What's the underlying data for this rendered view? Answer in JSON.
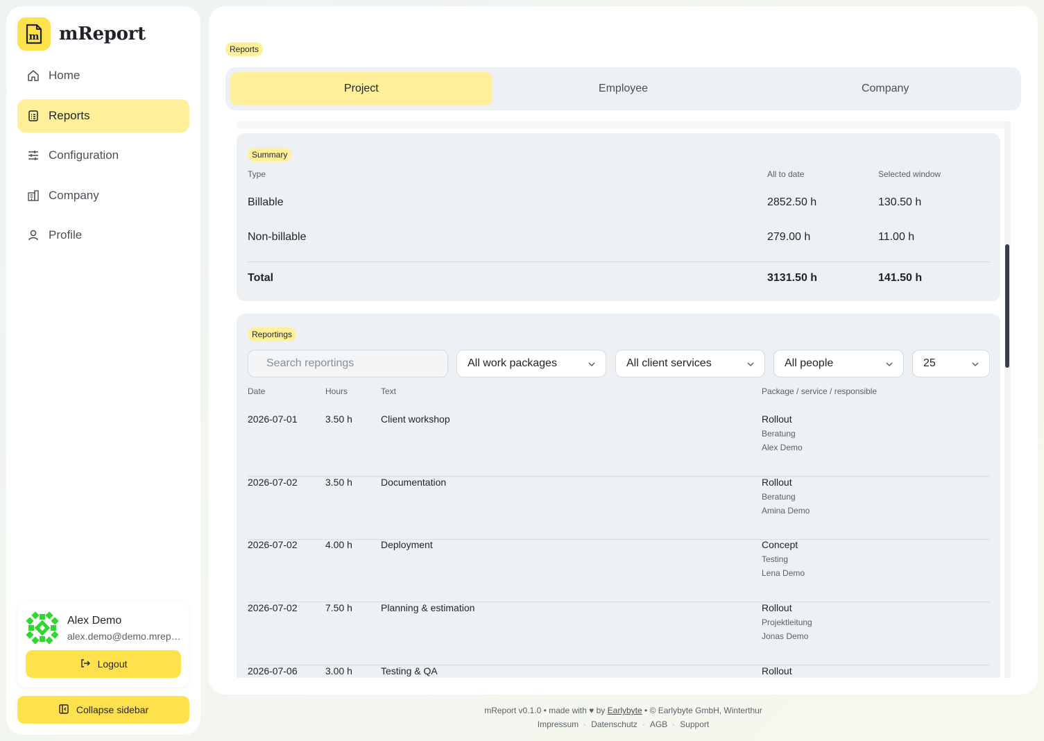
{
  "brand": {
    "name": "mReport",
    "logo_letter": "m"
  },
  "sidebar": {
    "items": [
      {
        "label": "Home",
        "icon": "home-icon",
        "active": false
      },
      {
        "label": "Reports",
        "icon": "report-icon",
        "active": true
      },
      {
        "label": "Configuration",
        "icon": "sliders-icon",
        "active": false
      },
      {
        "label": "Company",
        "icon": "building-icon",
        "active": false
      },
      {
        "label": "Profile",
        "icon": "user-icon",
        "active": false
      }
    ],
    "user": {
      "name": "Alex Demo",
      "email": "alex.demo@demo.mreport.ch"
    },
    "logout_label": "Logout",
    "collapse_label": "Collapse sidebar"
  },
  "page": {
    "section_pill": "Reports"
  },
  "tabs": [
    {
      "label": "Project",
      "active": true
    },
    {
      "label": "Employee",
      "active": false
    },
    {
      "label": "Company",
      "active": false
    }
  ],
  "summary": {
    "pill": "Summary",
    "headers": {
      "type": "Type",
      "all_to_date": "All to date",
      "selected_window": "Selected window"
    },
    "rows": [
      {
        "type": "Billable",
        "all_to_date": "2852.50 h",
        "selected_window": "130.50 h"
      },
      {
        "type": "Non-billable",
        "all_to_date": "279.00 h",
        "selected_window": "11.00 h"
      }
    ],
    "total": {
      "type": "Total",
      "all_to_date": "3131.50 h",
      "selected_window": "141.50 h"
    }
  },
  "reportings": {
    "pill": "Reportings",
    "search_placeholder": "Search reportings",
    "filters": {
      "work_packages": "All work packages",
      "client_services": "All client services",
      "people": "All people",
      "page_size": "25"
    },
    "headers": {
      "date": "Date",
      "hours": "Hours",
      "text": "Text",
      "package": "Package / service / responsible"
    },
    "rows": [
      {
        "date": "2026-07-01",
        "hours": "3.50 h",
        "text": "Client workshop",
        "package": "Rollout",
        "service": "Beratung",
        "responsible": "Alex Demo"
      },
      {
        "date": "2026-07-02",
        "hours": "3.50 h",
        "text": "Documentation",
        "package": "Rollout",
        "service": "Beratung",
        "responsible": "Amina Demo"
      },
      {
        "date": "2026-07-02",
        "hours": "4.00 h",
        "text": "Deployment",
        "package": "Concept",
        "service": "Testing",
        "responsible": "Lena Demo"
      },
      {
        "date": "2026-07-02",
        "hours": "7.50 h",
        "text": "Planning & estimation",
        "package": "Rollout",
        "service": "Projektleitung",
        "responsible": "Jonas Demo"
      },
      {
        "date": "2026-07-06",
        "hours": "3.00 h",
        "text": "Testing & QA",
        "package": "Rollout",
        "service": "",
        "responsible": ""
      }
    ]
  },
  "footer": {
    "prefix": "mReport v0.1.0 • made with",
    "by": "by",
    "company_link": "Earlybyte",
    "suffix": "• © Earlybyte GmbH, Winterthur",
    "links": [
      "Impressum",
      "Datenschutz",
      "AGB",
      "Support"
    ]
  },
  "colors": {
    "accent": "#ffe14d",
    "accent_soft": "#fff099",
    "surface": "#edf1f4"
  }
}
